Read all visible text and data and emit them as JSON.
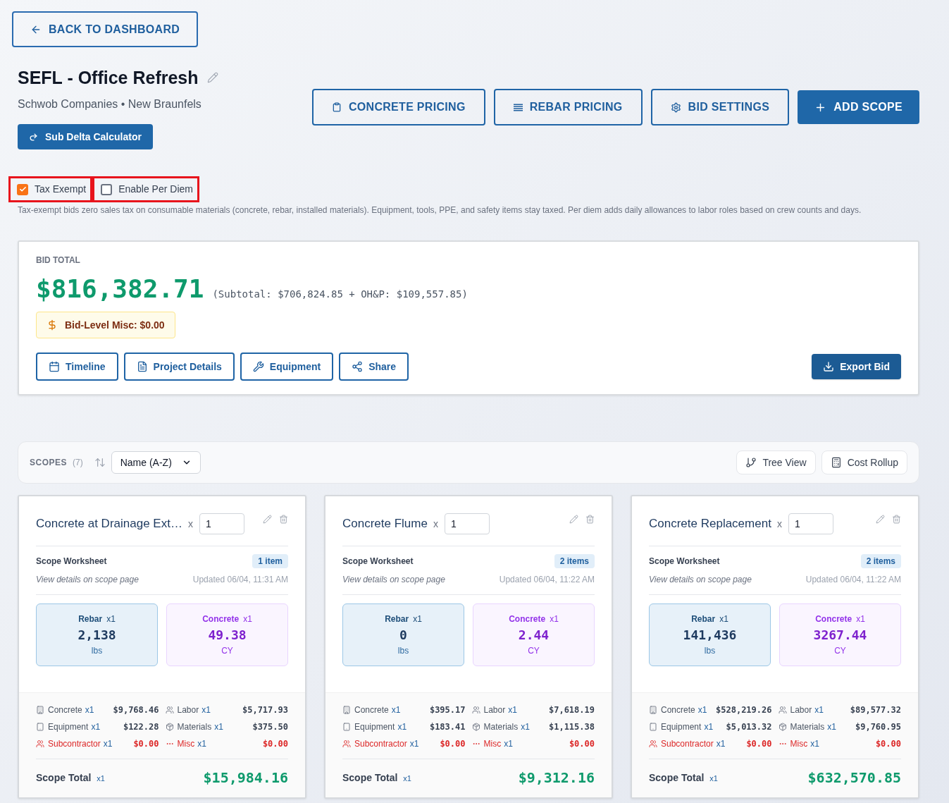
{
  "back_button": {
    "label": "BACK TO DASHBOARD"
  },
  "project": {
    "title": "SEFL - Office Refresh",
    "subtitle": "Schwob Companies • New Braunfels",
    "calculator_button": "Sub Delta Calculator"
  },
  "header_buttons": [
    {
      "label": "CONCRETE PRICING",
      "kind": "outline"
    },
    {
      "label": "REBAR PRICING",
      "kind": "outline"
    },
    {
      "label": "BID SETTINGS",
      "kind": "outline"
    },
    {
      "label": "ADD SCOPE",
      "kind": "primary"
    }
  ],
  "options": [
    {
      "label": "Tax Exempt",
      "checked": true,
      "highlighted": true
    },
    {
      "label": "Enable Per Diem",
      "checked": false,
      "highlighted": true
    }
  ],
  "options_note": "Tax-exempt bids zero sales tax on consumable materials (concrete, rebar, installed materials). Equipment, tools, PPE, and safety items stay taxed. Per diem adds daily allowances to labor roles based on crew counts and days.",
  "bid_total": {
    "label": "BID TOTAL",
    "amount": "$816,382.71",
    "breakdown": "(Subtotal: $706,824.85 + OH&P: $109,557.85)",
    "misc_badge": "Bid-Level Misc: $0.00",
    "actions": [
      "Timeline",
      "Project Details",
      "Equipment",
      "Share"
    ],
    "export_button": "Export Bid"
  },
  "scopes_bar": {
    "label": "SCOPES",
    "count": "(7)",
    "sort": "Name (A-Z)",
    "buttons": [
      "Tree View",
      "Cost Rollup"
    ]
  },
  "scopes": [
    {
      "title": "Concrete at Drainage Ext…",
      "multiply_sign": "x",
      "quantity": "1",
      "worksheet_label": "Scope Worksheet",
      "items_badge": "1 item",
      "view_note": "View details on scope page",
      "updated": "Updated 06/04, 11:31 AM",
      "tiles": [
        {
          "kind": "rebar",
          "label": "Rebar",
          "multiplier": "x1",
          "value": "2,138",
          "unit": "lbs"
        },
        {
          "kind": "concrete",
          "label": "Concrete",
          "multiplier": "x1",
          "value": "49.38",
          "unit": "CY"
        }
      ],
      "costs": [
        {
          "kind": "standard",
          "label": "Concrete",
          "multiplier": "x1",
          "value": "$9,768.46"
        },
        {
          "kind": "standard",
          "label": "Labor",
          "multiplier": "x1",
          "value": "$5,717.93"
        },
        {
          "kind": "standard",
          "label": "Equipment",
          "multiplier": "x1",
          "value": "$122.28"
        },
        {
          "kind": "standard",
          "label": "Materials",
          "multiplier": "x1",
          "value": "$375.50"
        },
        {
          "kind": "alert",
          "label": "Subcontractor",
          "multiplier": "x1",
          "value": "$0.00"
        },
        {
          "kind": "alert",
          "label": "Misc",
          "multiplier": "x1",
          "value": "$0.00"
        }
      ],
      "total_label": "Scope Total",
      "total_multiplier": "x1",
      "total": "$15,984.16"
    },
    {
      "title": "Concrete Flume",
      "multiply_sign": "x",
      "quantity": "1",
      "worksheet_label": "Scope Worksheet",
      "items_badge": "2 items",
      "view_note": "View details on scope page",
      "updated": "Updated 06/04, 11:22 AM",
      "tiles": [
        {
          "kind": "rebar",
          "label": "Rebar",
          "multiplier": "x1",
          "value": "0",
          "unit": "lbs"
        },
        {
          "kind": "concrete",
          "label": "Concrete",
          "multiplier": "x1",
          "value": "2.44",
          "unit": "CY"
        }
      ],
      "costs": [
        {
          "kind": "standard",
          "label": "Concrete",
          "multiplier": "x1",
          "value": "$395.17"
        },
        {
          "kind": "standard",
          "label": "Labor",
          "multiplier": "x1",
          "value": "$7,618.19"
        },
        {
          "kind": "standard",
          "label": "Equipment",
          "multiplier": "x1",
          "value": "$183.41"
        },
        {
          "kind": "standard",
          "label": "Materials",
          "multiplier": "x1",
          "value": "$1,115.38"
        },
        {
          "kind": "alert",
          "label": "Subcontractor",
          "multiplier": "x1",
          "value": "$0.00"
        },
        {
          "kind": "alert",
          "label": "Misc",
          "multiplier": "x1",
          "value": "$0.00"
        }
      ],
      "total_label": "Scope Total",
      "total_multiplier": "x1",
      "total": "$9,312.16"
    },
    {
      "title": "Concrete Replacement",
      "multiply_sign": "x",
      "quantity": "1",
      "worksheet_label": "Scope Worksheet",
      "items_badge": "2 items",
      "view_note": "View details on scope page",
      "updated": "Updated 06/04, 11:22 AM",
      "tiles": [
        {
          "kind": "rebar",
          "label": "Rebar",
          "multiplier": "x1",
          "value": "141,436",
          "unit": "lbs"
        },
        {
          "kind": "concrete",
          "label": "Concrete",
          "multiplier": "x1",
          "value": "3267.44",
          "unit": "CY"
        }
      ],
      "costs": [
        {
          "kind": "standard",
          "label": "Concrete",
          "multiplier": "x1",
          "value": "$528,219.26"
        },
        {
          "kind": "standard",
          "label": "Labor",
          "multiplier": "x1",
          "value": "$89,577.32"
        },
        {
          "kind": "standard",
          "label": "Equipment",
          "multiplier": "x1",
          "value": "$5,013.32"
        },
        {
          "kind": "standard",
          "label": "Materials",
          "multiplier": "x1",
          "value": "$9,760.95"
        },
        {
          "kind": "alert",
          "label": "Subcontractor",
          "multiplier": "x1",
          "value": "$0.00"
        },
        {
          "kind": "alert",
          "label": "Misc",
          "multiplier": "x1",
          "value": "$0.00"
        }
      ],
      "total_label": "Scope Total",
      "total_multiplier": "x1",
      "total": "$632,570.85"
    }
  ]
}
